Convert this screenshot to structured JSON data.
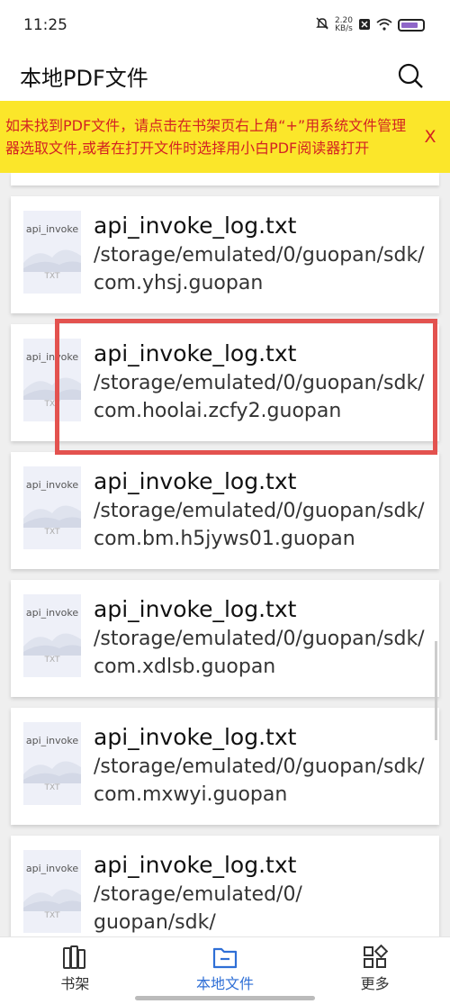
{
  "status": {
    "time": "11:25",
    "net_speed_value": "2.20",
    "net_speed_unit": "KB/s"
  },
  "header": {
    "title": "本地PDF文件",
    "search_icon": "search-icon"
  },
  "notice": {
    "text": "如未找到PDF文件，请点击在书架页右上角“+”用系统文件管理器选取文件,或者在打开文件时选择用小白PDF阅读器打开",
    "close_label": "X"
  },
  "files": [
    {
      "thumb_name": "api_invoke",
      "thumb_ext": "TXT",
      "name": "api_invoke_log.txt",
      "path": "/storage/emulated/0/guopan/sdk/com.yhsj.guopan"
    },
    {
      "thumb_name": "api_invoke",
      "thumb_ext": "TXT",
      "name": "api_invoke_log.txt",
      "path": "/storage/emulated/0/guopan/sdk/com.hoolai.zcfy2.guopan"
    },
    {
      "thumb_name": "api_invoke",
      "thumb_ext": "TXT",
      "name": "api_invoke_log.txt",
      "path": "/storage/emulated/0/guopan/sdk/com.bm.h5jyws01.guopan"
    },
    {
      "thumb_name": "api_invoke",
      "thumb_ext": "TXT",
      "name": "api_invoke_log.txt",
      "path": "/storage/emulated/0/guopan/sdk/com.xdlsb.guopan"
    },
    {
      "thumb_name": "api_invoke",
      "thumb_ext": "TXT",
      "name": "api_invoke_log.txt",
      "path": "/storage/emulated/0/guopan/sdk/com.mxwyi.guopan"
    },
    {
      "thumb_name": "api_invoke",
      "thumb_ext": "TXT",
      "name": "api_invoke_log.txt",
      "path": "/storage/emulated/0/guopan/sdk/"
    }
  ],
  "nav": {
    "bookshelf": "书架",
    "local_files": "本地文件",
    "more": "更多"
  },
  "colors": {
    "notice_bg": "#fbe62a",
    "notice_text": "#d32323",
    "highlight": "#e3524f",
    "accent": "#2f6fd6"
  }
}
